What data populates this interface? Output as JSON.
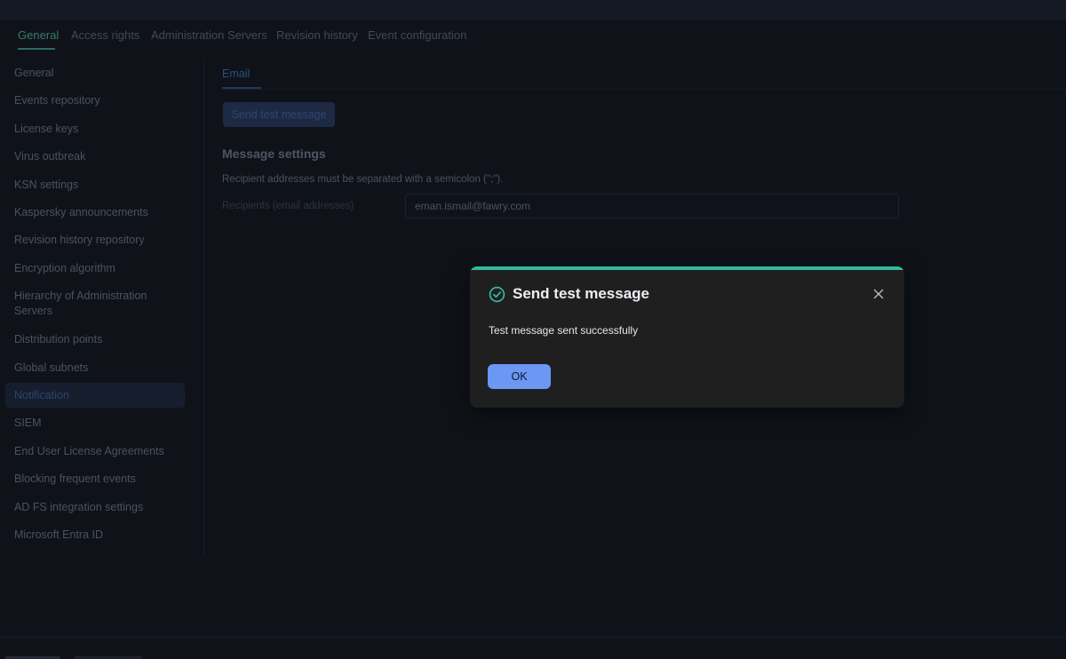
{
  "top_tabs": [
    "General",
    "Access rights",
    "Administration Servers",
    "Revision history",
    "Event configuration"
  ],
  "sidebar": {
    "items": [
      {
        "label": "General"
      },
      {
        "label": "Events repository"
      },
      {
        "label": "License keys"
      },
      {
        "label": "Virus outbreak"
      },
      {
        "label": "KSN settings"
      },
      {
        "label": "Kaspersky announcements"
      },
      {
        "label": "Revision history repository"
      },
      {
        "label": "Encryption algorithm"
      },
      {
        "label": "Hierarchy of Administration Servers"
      },
      {
        "label": "Distribution points"
      },
      {
        "label": "Global subnets"
      },
      {
        "label": "Notification",
        "active": true
      },
      {
        "label": "SIEM"
      },
      {
        "label": "End User License Agreements"
      },
      {
        "label": "Blocking frequent events"
      },
      {
        "label": "AD FS integration settings"
      },
      {
        "label": "Microsoft Entra ID"
      }
    ]
  },
  "content": {
    "subtab": "Email",
    "send_button": "Send test message",
    "section_title": "Message settings",
    "hint": "Recipient addresses must be separated with a semicolon (\";\").",
    "recipients_label": "Recipients (email addresses)",
    "recipients_value": "eman.ismail@fawry.com"
  },
  "dialog": {
    "title": "Send test message",
    "message": "Test message sent successfully",
    "ok_label": "OK",
    "icon": "check-circle-icon",
    "accent_color": "#34b89f"
  },
  "colors": {
    "background": "#0f1319",
    "dialog_bg": "#1f1f20",
    "primary_button": "#6b97f5"
  }
}
